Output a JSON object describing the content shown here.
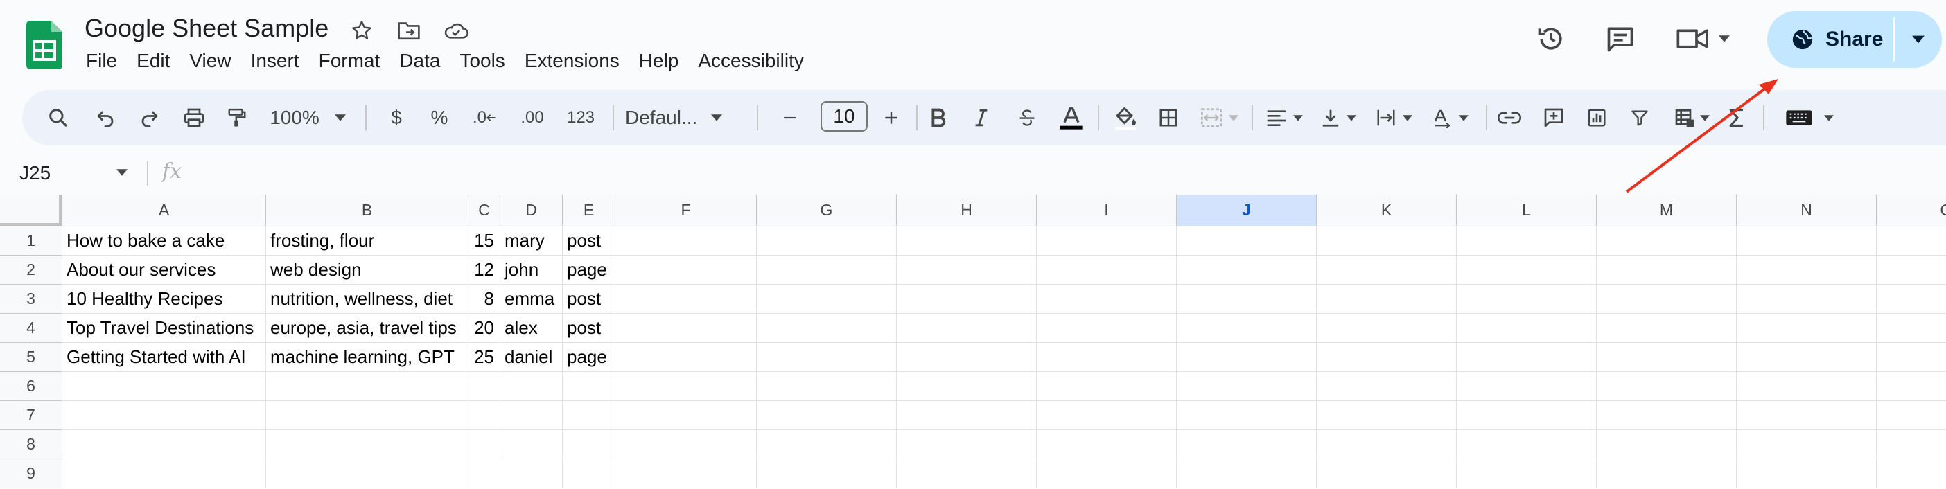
{
  "doc": {
    "title": "Google Sheet Sample"
  },
  "menu": [
    "File",
    "Edit",
    "View",
    "Insert",
    "Format",
    "Data",
    "Tools",
    "Extensions",
    "Help",
    "Accessibility"
  ],
  "share": {
    "label": "Share"
  },
  "toolbar": {
    "zoom": "100%",
    "currency": "$",
    "percent": "%",
    "dec_decrease": ".0",
    "dec_increase": ".00",
    "number_format": "123",
    "font": "Defaul...",
    "font_size": "10"
  },
  "namebox": {
    "value": "J25"
  },
  "formula": {
    "label": "fx"
  },
  "colors": {
    "accent": "#0b57d0",
    "share_bg": "#c2e7ff",
    "annotation_arrow": "#e8321e",
    "logo_green": "#0f9d58"
  },
  "grid": {
    "columns": [
      "A",
      "B",
      "C",
      "D",
      "E",
      "F",
      "G",
      "H",
      "I",
      "J",
      "K",
      "L",
      "M",
      "N",
      "O"
    ],
    "selected_column": "J",
    "rows": [
      "1",
      "2",
      "3",
      "4",
      "5",
      "6",
      "7",
      "8",
      "9"
    ],
    "data": [
      [
        "How to bake a cake",
        "frosting, flour",
        "15",
        "mary",
        "post"
      ],
      [
        "About our services",
        "web design",
        "12",
        "john",
        "page"
      ],
      [
        "10 Healthy Recipes",
        "nutrition, wellness, diet",
        "8",
        "emma",
        "post"
      ],
      [
        "Top Travel Destinations",
        "europe, asia, travel tips",
        "20",
        "alex",
        "post"
      ],
      [
        "Getting Started with AI",
        "machine learning, GPT",
        "25",
        "daniel",
        "page"
      ]
    ]
  }
}
